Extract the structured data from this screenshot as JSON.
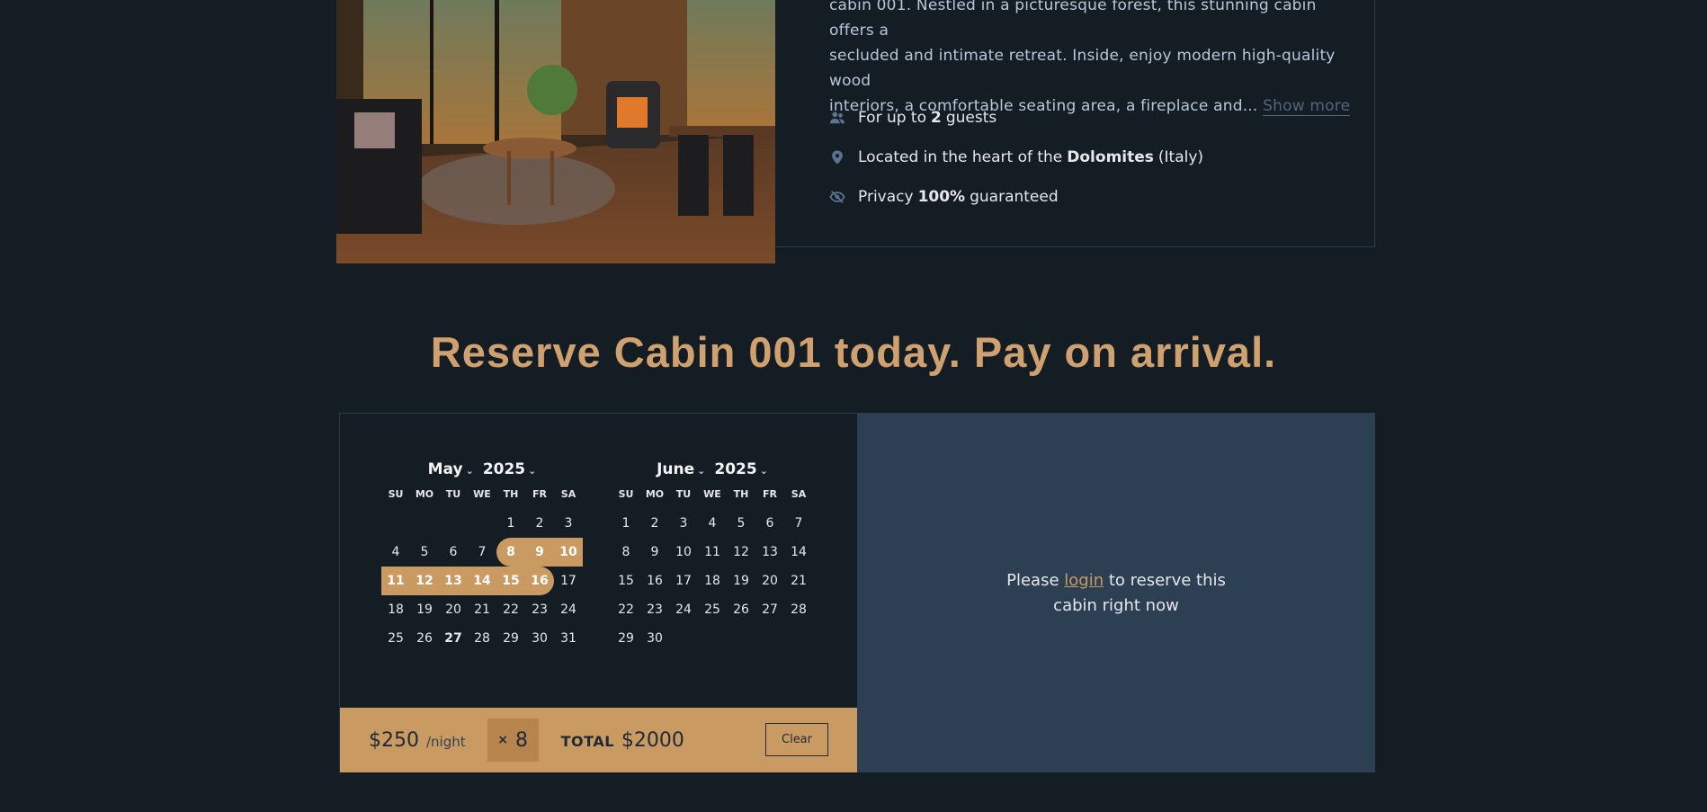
{
  "cabin": {
    "desc_line1": "cabin 001. Nestled in a picturesque forest, this stunning cabin offers a",
    "desc_line2": "secluded and intimate retreat. Inside, enjoy modern high-quality wood",
    "desc_line3": "interiors, a comfortable seating area, a fireplace and...",
    "show_more": "Show more",
    "features": [
      {
        "icon": "users-icon",
        "pre": "For up to",
        "bold": "2",
        "post": "guests"
      },
      {
        "icon": "map-pin-icon",
        "pre": "Located in the heart of the",
        "bold": "Dolomites",
        "post": "(Italy)"
      },
      {
        "icon": "eye-slash-icon",
        "pre": "Privacy",
        "bold": "100%",
        "post": "guaranteed"
      }
    ]
  },
  "reserve_title": "Reserve Cabin 001 today. Pay on arrival.",
  "calendar": {
    "weekdays": [
      "SU",
      "MO",
      "TU",
      "WE",
      "TH",
      "FR",
      "SA"
    ],
    "months": [
      {
        "month": "May",
        "year": "2025",
        "weeks": [
          [
            "",
            "",
            "",
            "",
            "1",
            "2",
            "3"
          ],
          [
            "4",
            "5",
            "6",
            "7",
            "8",
            "9",
            "10"
          ],
          [
            "11",
            "12",
            "13",
            "14",
            "15",
            "16",
            "17"
          ],
          [
            "18",
            "19",
            "20",
            "21",
            "22",
            "23",
            "24"
          ],
          [
            "25",
            "26",
            "27",
            "28",
            "29",
            "30",
            "31"
          ]
        ]
      },
      {
        "month": "June",
        "year": "2025",
        "weeks": [
          [
            "1",
            "2",
            "3",
            "4",
            "5",
            "6",
            "7"
          ],
          [
            "8",
            "9",
            "10",
            "11",
            "12",
            "13",
            "14"
          ],
          [
            "15",
            "16",
            "17",
            "18",
            "19",
            "20",
            "21"
          ],
          [
            "22",
            "23",
            "24",
            "25",
            "26",
            "27",
            "28"
          ],
          [
            "29",
            "30",
            "",
            "",
            "",
            "",
            ""
          ]
        ]
      }
    ],
    "selected_range": {
      "month": "May",
      "start": 8,
      "end": 16
    },
    "today": {
      "month": "May",
      "day": 27
    }
  },
  "pricing": {
    "price": "$250",
    "per_night": "/night",
    "nights_prefix": "×",
    "nights": "8",
    "total_label": "TOTAL",
    "total": "$2000",
    "clear": "Clear"
  },
  "login": {
    "before": "Please",
    "link": "login",
    "after": "to reserve this cabin right now"
  },
  "colors": {
    "background": "#141c24",
    "accent": "#c99a62",
    "panel": "#2d3f52"
  }
}
